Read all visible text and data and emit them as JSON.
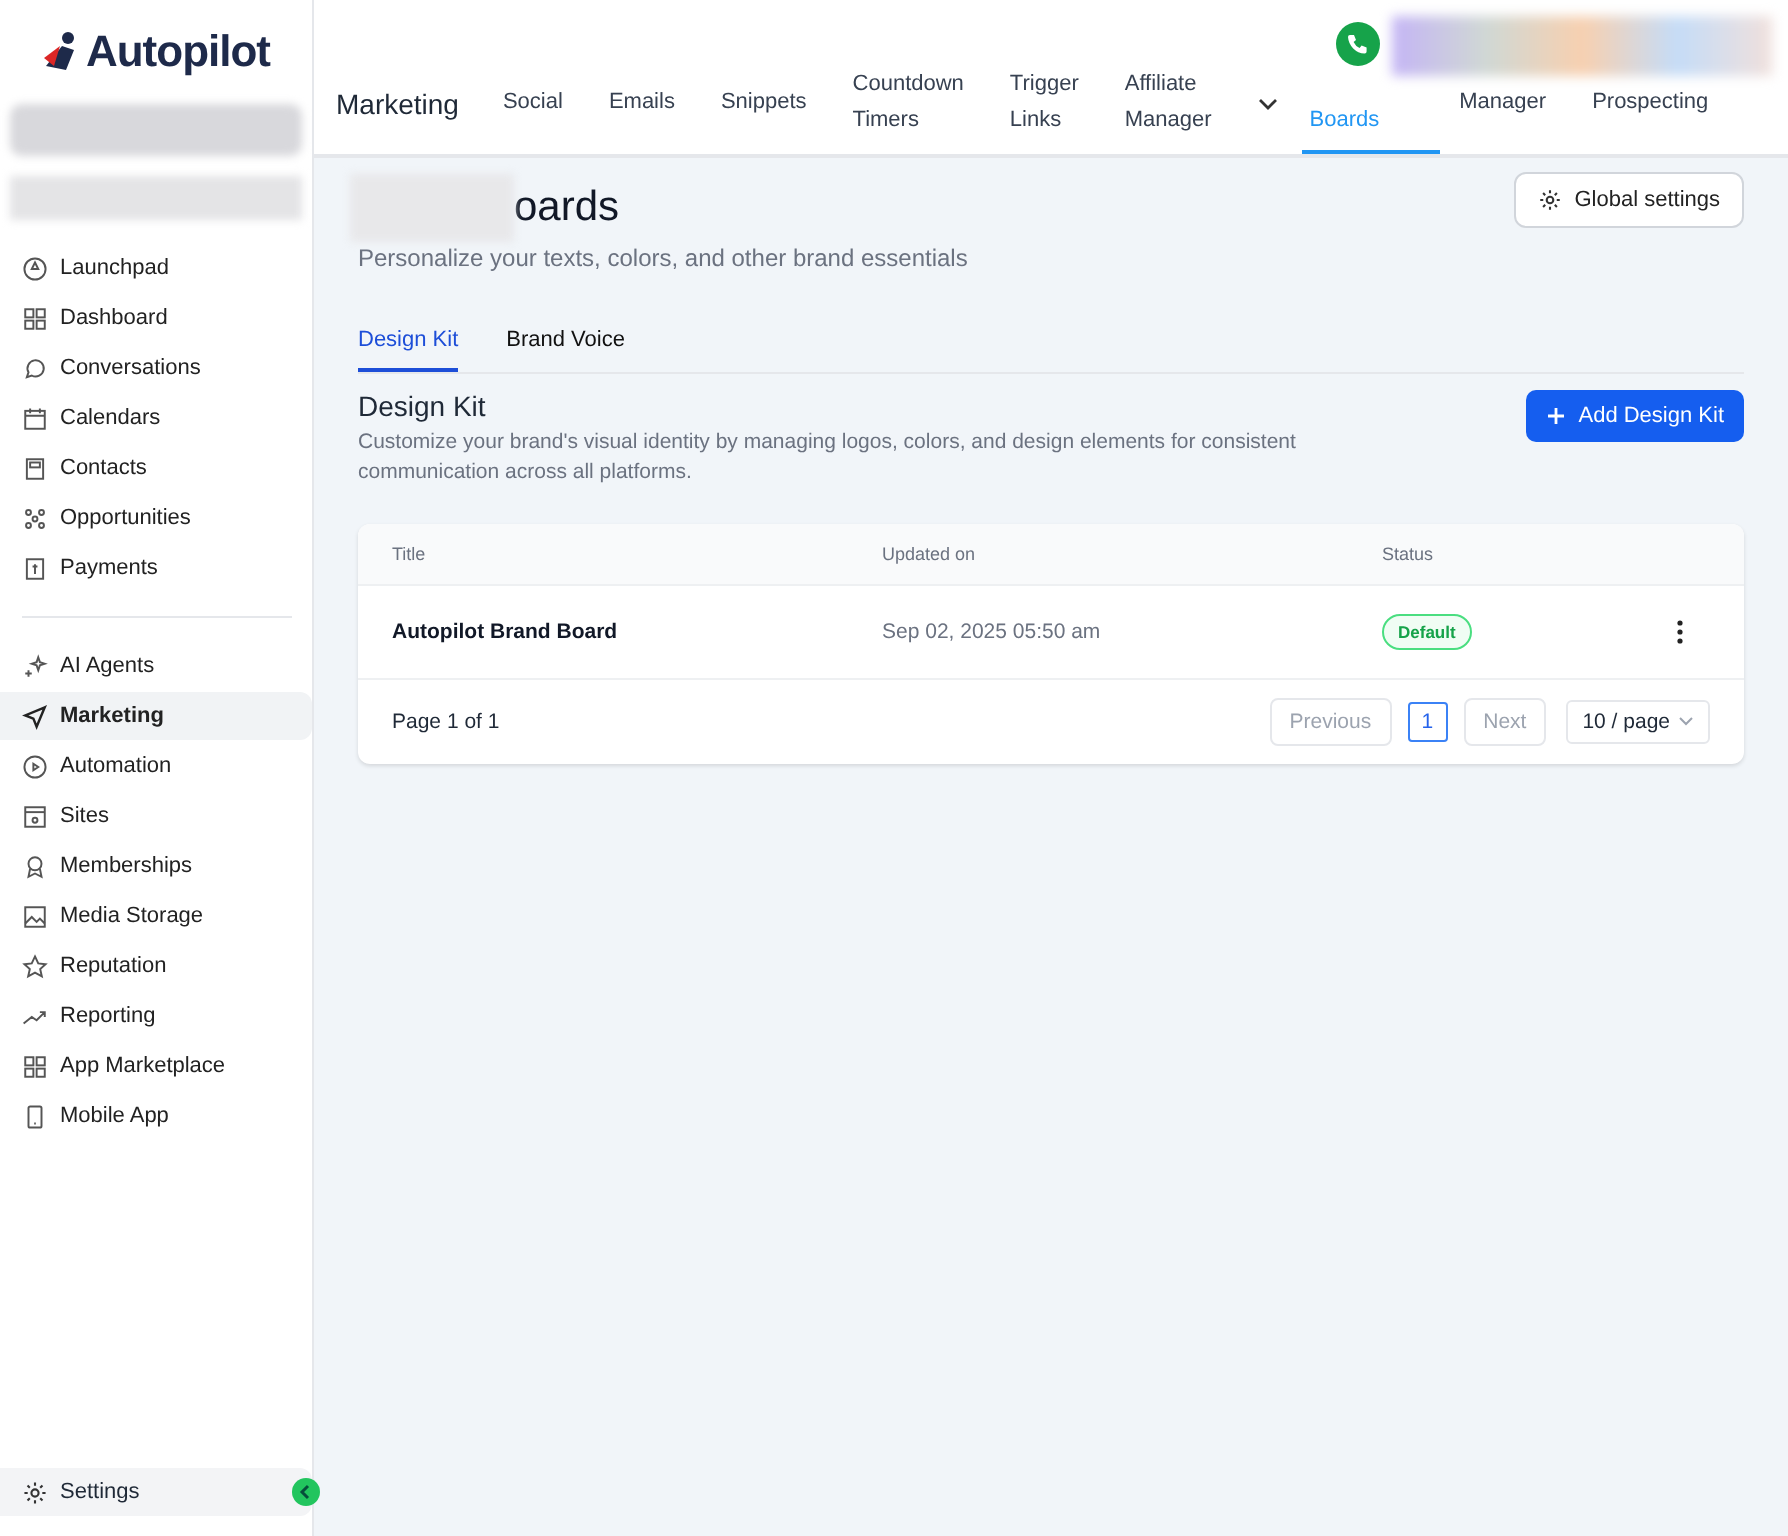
{
  "sidebar": {
    "logo": "Autopilot",
    "groups": [
      {
        "items": [
          {
            "label": "Launchpad",
            "selected": false
          },
          {
            "label": "Dashboard",
            "selected": false
          },
          {
            "label": "Conversations",
            "selected": false
          },
          {
            "label": "Calendars",
            "selected": false
          },
          {
            "label": "Contacts",
            "selected": false
          },
          {
            "label": "Opportunities",
            "selected": false
          },
          {
            "label": "Payments",
            "selected": false
          }
        ]
      },
      {
        "items": [
          {
            "label": "AI Agents",
            "selected": false
          },
          {
            "label": "Marketing",
            "selected": true
          },
          {
            "label": "Automation",
            "selected": false
          },
          {
            "label": "Sites",
            "selected": false
          },
          {
            "label": "Memberships",
            "selected": false
          },
          {
            "label": "Media Storage",
            "selected": false
          },
          {
            "label": "Reputation",
            "selected": false
          },
          {
            "label": "Reporting",
            "selected": false
          },
          {
            "label": "App Marketplace",
            "selected": false
          },
          {
            "label": "Mobile App",
            "selected": false
          }
        ]
      }
    ],
    "footer_item": {
      "label": "Settings"
    }
  },
  "top_nav": {
    "section": "Marketing",
    "items": [
      {
        "label": "Social",
        "selected": false
      },
      {
        "label": "Emails",
        "selected": false
      },
      {
        "label": "Snippets",
        "selected": false
      },
      {
        "label": "Countdown Timers",
        "selected": false
      },
      {
        "label": "Trigger Links",
        "selected": false
      },
      {
        "label": "Affiliate Manager",
        "selected": false
      },
      {
        "label": "Boards",
        "selected": true
      },
      {
        "label": "Manager",
        "selected": false
      },
      {
        "label": "Prospecting",
        "selected": false
      }
    ]
  },
  "page": {
    "title": "oards",
    "subtitle": "Personalize your texts, colors, and other brand essentials",
    "global_settings": "Global settings",
    "tabs": [
      {
        "label": "Design Kit",
        "selected": true
      },
      {
        "label": "Brand Voice",
        "selected": false
      }
    ],
    "section_title": "Design Kit",
    "section_description": "Customize your brand's visual identity by managing logos, colors, and design elements for consistent communication across all platforms.",
    "add_button": "Add Design Kit",
    "table": {
      "columns": [
        "Title",
        "Updated on",
        "Status"
      ],
      "rows": [
        {
          "title": "Autopilot Brand Board",
          "updated_on": "Sep 02, 2025 05:50 am",
          "status": "Default"
        }
      ],
      "footer": {
        "page_info": "Page 1 of 1",
        "previous": {
          "label": "Previous",
          "disabled": true
        },
        "pages": [
          {
            "label": "1",
            "selected": true
          }
        ],
        "next": {
          "label": "Next",
          "disabled": true
        },
        "page_size": "10 / page"
      }
    }
  }
}
